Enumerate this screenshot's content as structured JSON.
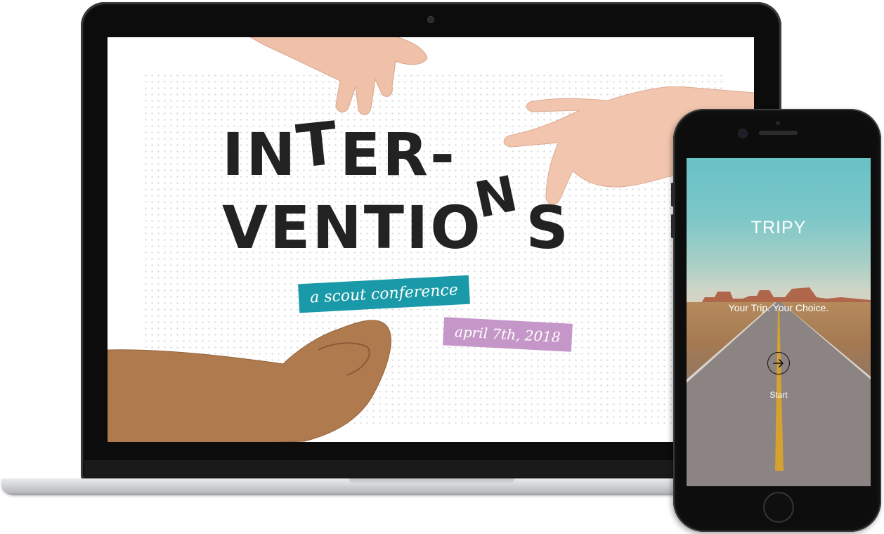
{
  "laptop": {
    "title_line_1": [
      "I",
      "N",
      "T",
      "E",
      "R",
      "-"
    ],
    "title_line_2": [
      "V",
      "E",
      "N",
      "T",
      "I",
      "O",
      "N",
      "S"
    ],
    "subtitle": "a scout conference",
    "date": "april 7th, 2018"
  },
  "phone": {
    "app_title": "TRIPY",
    "tagline": "Your Trip. Your Choice.",
    "start_label": "Start",
    "start_icon": "arrow-right-icon"
  },
  "colors": {
    "title_text": "#222222",
    "subtitle_tag": "#1a9aa8",
    "date_tag": "#c597c8",
    "sky_top": "#68c2c6"
  }
}
